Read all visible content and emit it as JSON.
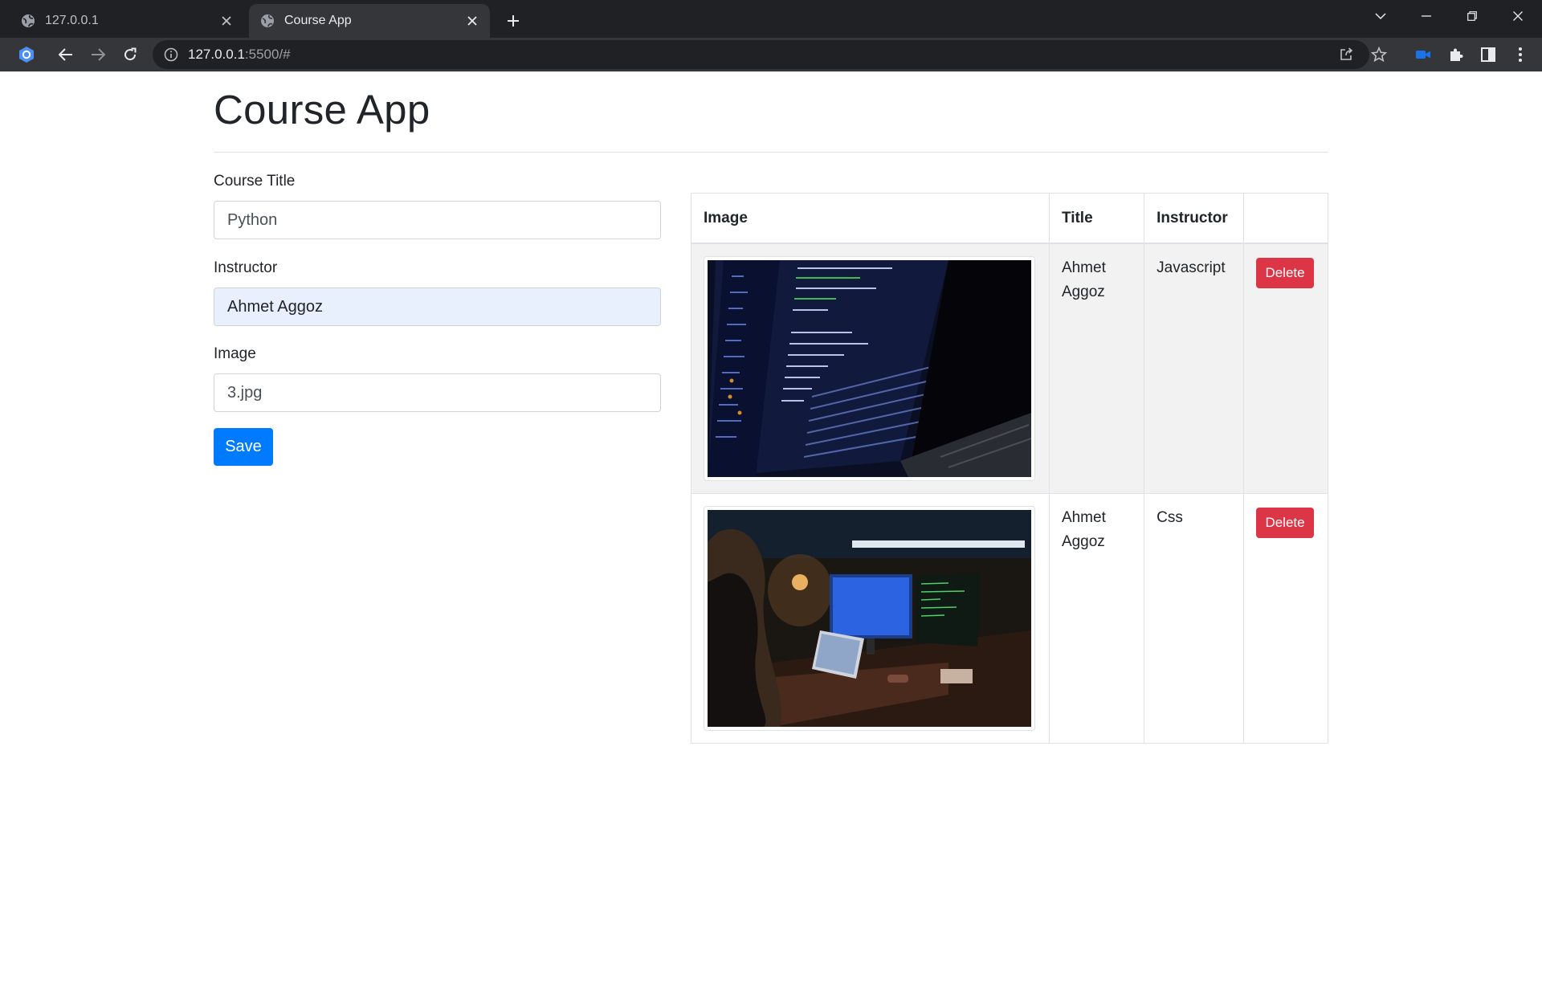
{
  "browser": {
    "tabs": [
      {
        "title": "127.0.0.1",
        "active": false
      },
      {
        "title": "Course App",
        "active": true
      }
    ],
    "url_host": "127.0.0.1",
    "url_rest": ":5500/#"
  },
  "page": {
    "heading": "Course App"
  },
  "form": {
    "title_label": "Course Title",
    "title_value": "Python",
    "instructor_label": "Instructor",
    "instructor_value": "Ahmet Aggoz",
    "image_label": "Image",
    "image_value": "3.jpg",
    "save_label": "Save"
  },
  "table": {
    "headers": [
      "Image",
      "Title",
      "Instructor",
      ""
    ],
    "rows": [
      {
        "image": "code-on-laptop-screen",
        "title": "Ahmet Aggoz",
        "instructor": "Javascript",
        "delete_label": "Delete"
      },
      {
        "image": "person-at-desk-with-monitors",
        "title": "Ahmet Aggoz",
        "instructor": "Css",
        "delete_label": "Delete"
      }
    ]
  },
  "colors": {
    "primary": "#007bff",
    "danger": "#dc3545",
    "autofill": "#e8f0fe"
  }
}
